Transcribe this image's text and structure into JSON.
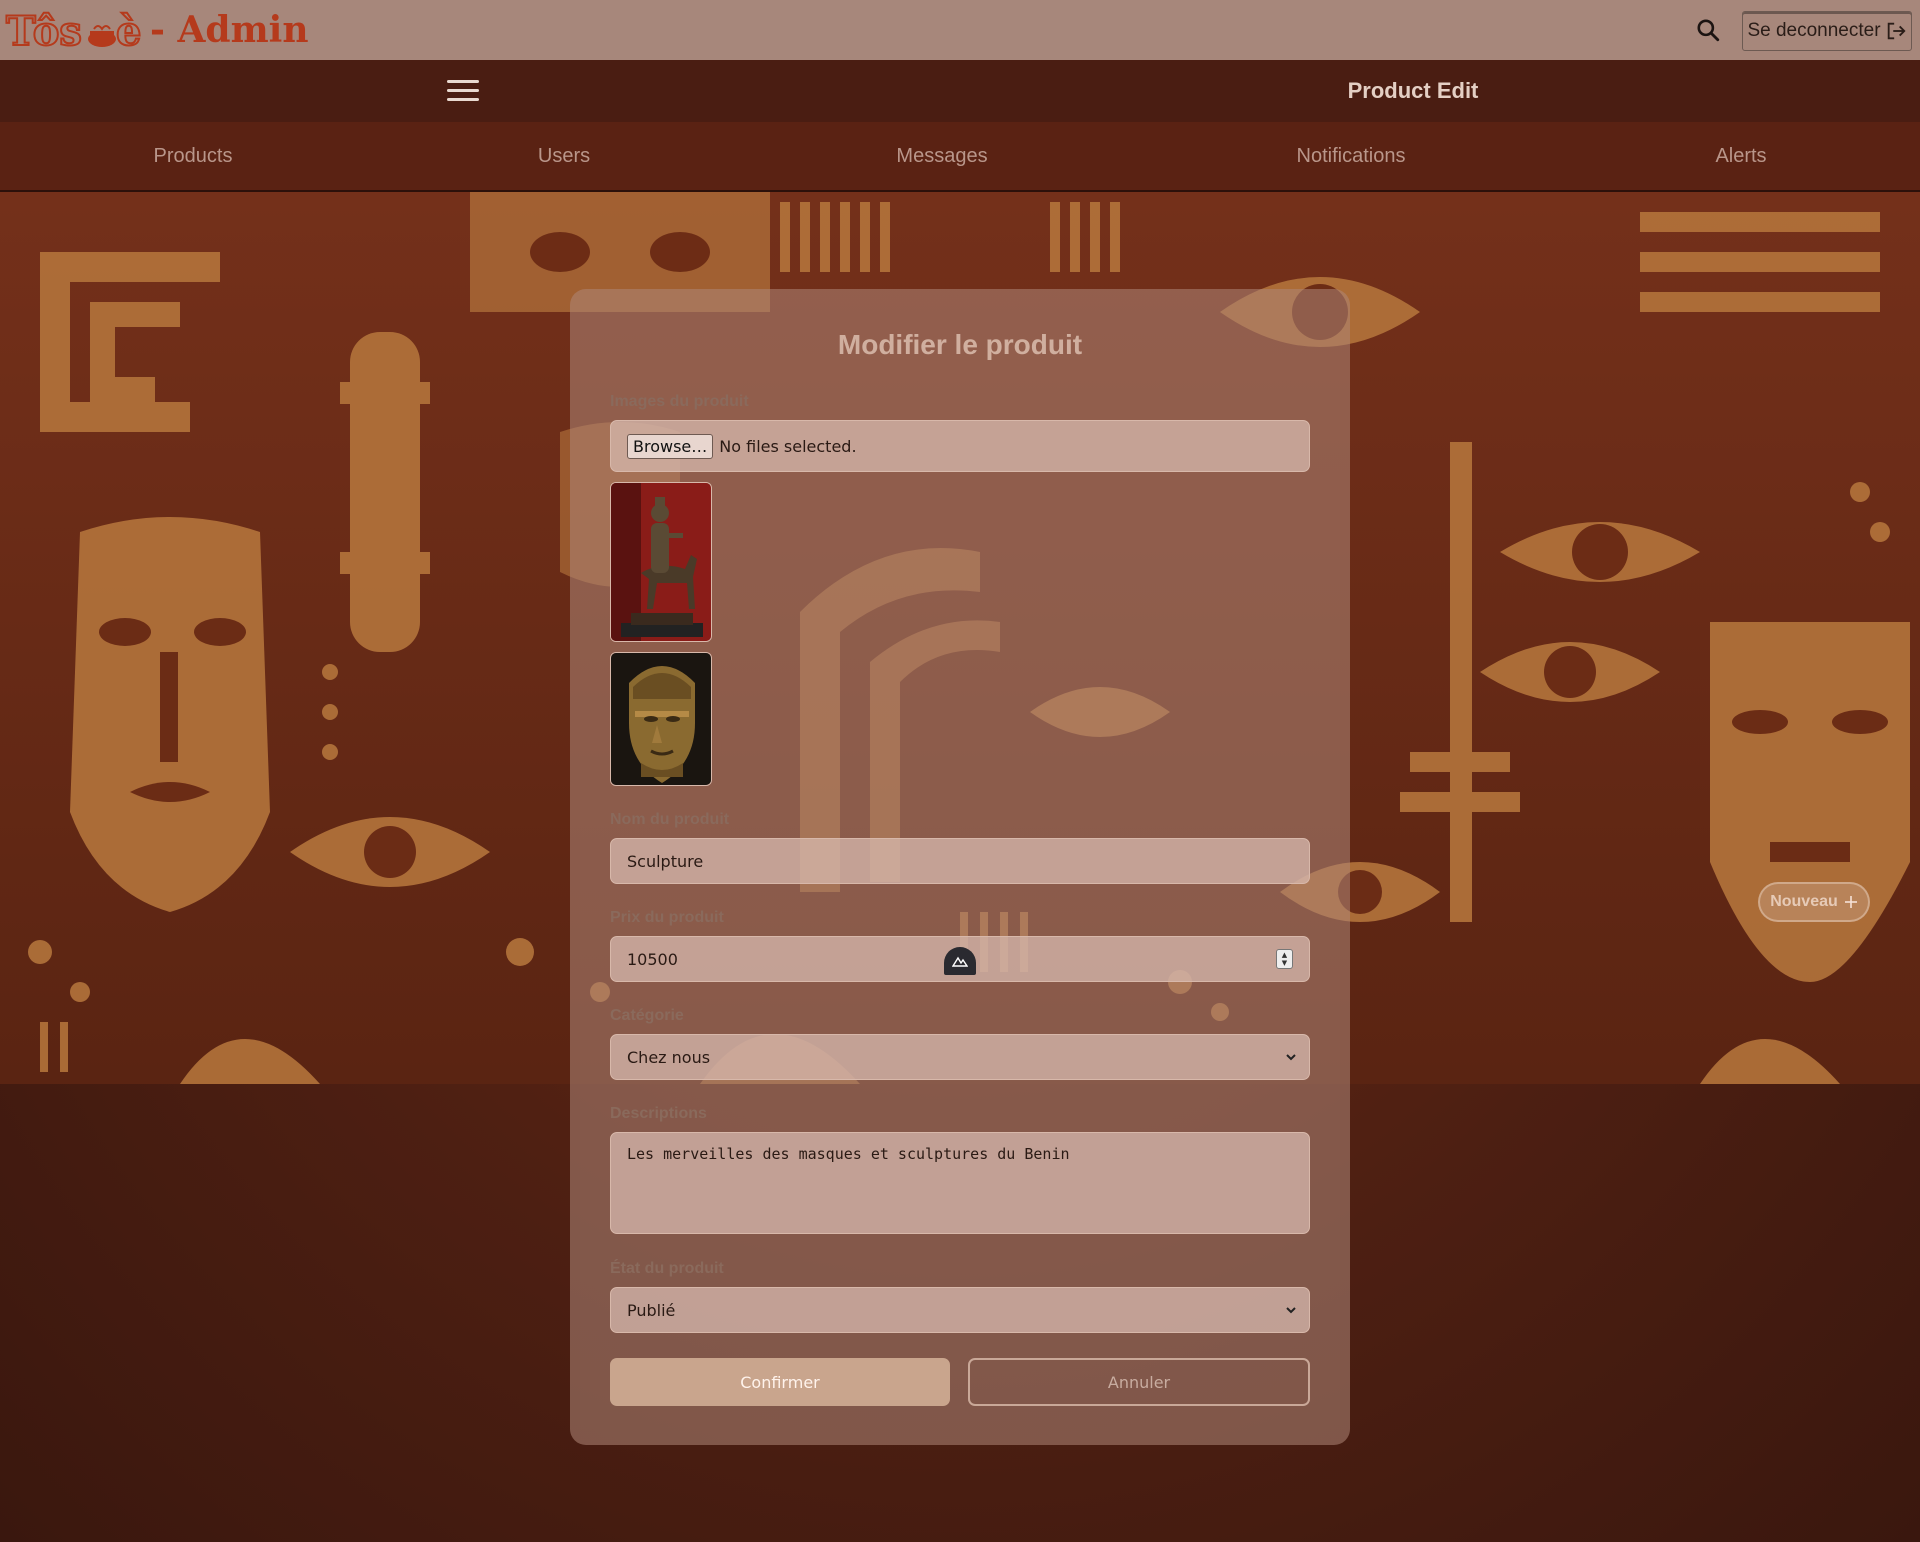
{
  "app": {
    "logo_text": "Tôsɔè",
    "logo_suffix": "- Admin",
    "logout_label": "Se deconnecter"
  },
  "header": {
    "page_title": "Product Edit"
  },
  "nav": {
    "items": [
      {
        "label": "Products"
      },
      {
        "label": "Users"
      },
      {
        "label": "Messages"
      },
      {
        "label": "Notifications"
      },
      {
        "label": "Alerts"
      }
    ]
  },
  "new_button": {
    "label": "Nouveau"
  },
  "form": {
    "title": "Modifier le produit",
    "images": {
      "label": "Images du produit",
      "browse_label": "Browse…",
      "status": "No files selected."
    },
    "name": {
      "label": "Nom du produit",
      "value": "Sculpture"
    },
    "price": {
      "label": "Prix du produit",
      "value": "10500"
    },
    "category": {
      "label": "Catégorie",
      "value": "Chez nous"
    },
    "description": {
      "label": "Descriptions",
      "value": "Les merveilles des masques et sculptures du Benin"
    },
    "status": {
      "label": "État du produit",
      "value": "Publié"
    },
    "confirm_label": "Confirmer",
    "cancel_label": "Annuler"
  },
  "colors": {
    "topbar": "#a7877b",
    "subheader": "#4a1d12",
    "nav": "#5a2213",
    "brand": "#b53a1c",
    "confirm": "#c9a58d"
  }
}
